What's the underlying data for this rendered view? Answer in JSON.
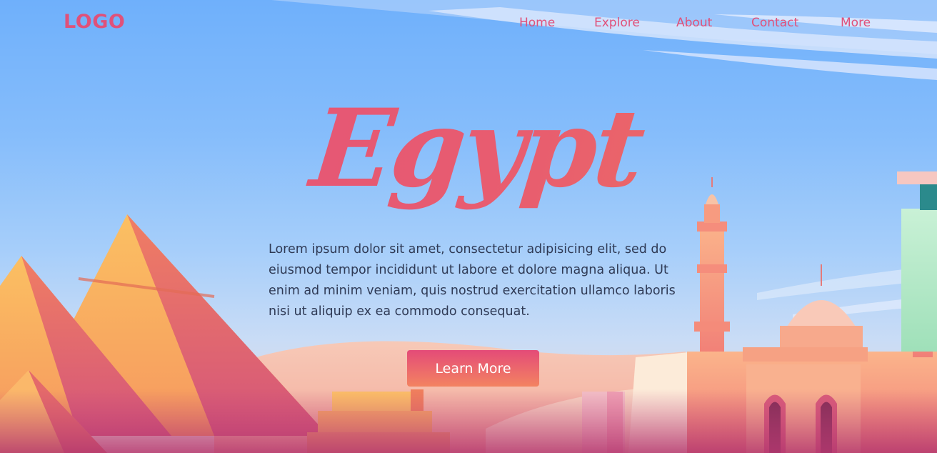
{
  "header": {
    "logo": "LOGO",
    "nav": [
      {
        "label": "Home"
      },
      {
        "label": "Explore"
      },
      {
        "label": "About"
      },
      {
        "label": "Contact"
      },
      {
        "label": "More"
      }
    ]
  },
  "hero": {
    "title": "Egypt",
    "description": "Lorem ipsum dolor sit amet, consectetur adipisicing elit, sed do eiusmod tempor incididunt ut labore et dolore magna aliqua. Ut enim ad minim veniam, quis nostrud exercitation ullamco laboris nisi ut aliquip ex ea commodo consequat.",
    "button_label": "Learn More"
  },
  "colors": {
    "accent": "#e0517a",
    "sky": "#6fb0fb",
    "button_gradient_start": "#e44b78",
    "button_gradient_end": "#f38361",
    "body_text": "#2f3a55"
  },
  "icons": [
    "pyramids-illustration",
    "mosque-illustration",
    "cloud-streaks"
  ]
}
